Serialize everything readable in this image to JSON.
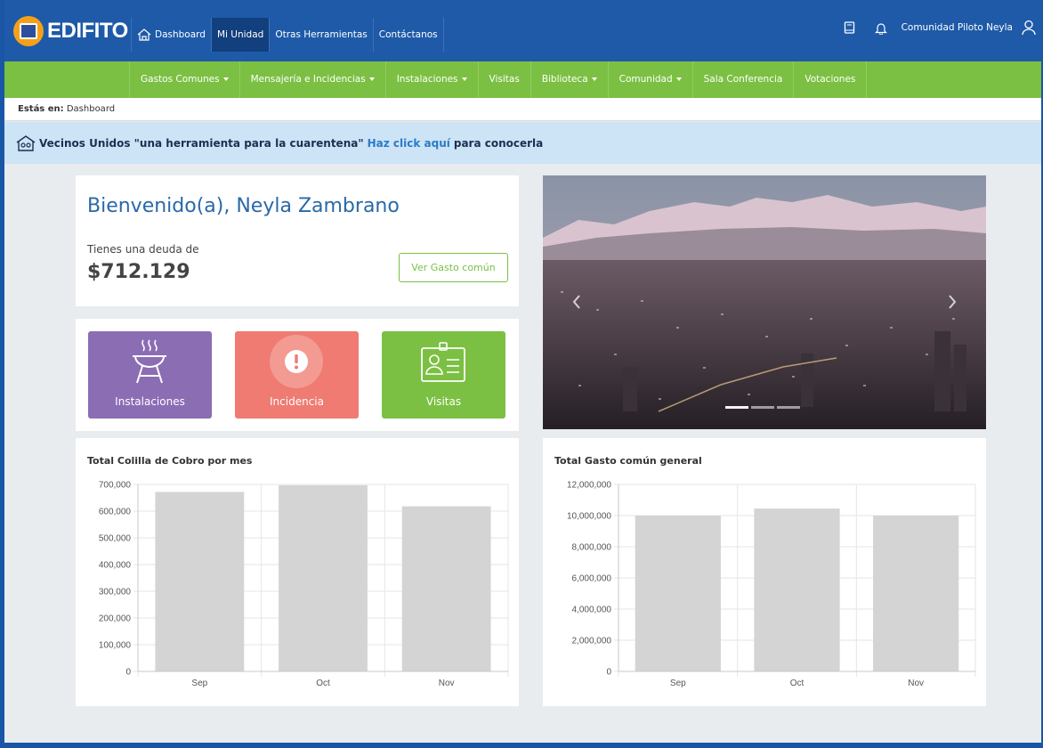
{
  "app": {
    "logo_text": "EDIFITO"
  },
  "top_nav": [
    {
      "label": "Dashboard",
      "icon": "home-icon",
      "active": false
    },
    {
      "label": "Mi Unidad",
      "active": true
    },
    {
      "label": "Otras Herramientas",
      "active": false
    },
    {
      "label": "Contáctanos",
      "active": false
    }
  ],
  "top_right": {
    "community": "Comunidad Piloto Neyla",
    "icons": [
      "book-icon",
      "bell-icon",
      "user-icon"
    ]
  },
  "green_nav": [
    {
      "label": "Gastos Comunes",
      "dropdown": true
    },
    {
      "label": "Mensajería e Incidencias",
      "dropdown": true
    },
    {
      "label": "Instalaciones",
      "dropdown": true
    },
    {
      "label": "Visitas",
      "dropdown": false
    },
    {
      "label": "Biblioteca",
      "dropdown": true
    },
    {
      "label": "Comunidad",
      "dropdown": true
    },
    {
      "label": "Sala Conferencia",
      "dropdown": false
    },
    {
      "label": "Votaciones",
      "dropdown": false
    }
  ],
  "breadcrumb": {
    "prefix": "Estás en:",
    "current": "Dashboard"
  },
  "banner": {
    "text": "Vecinos Unidos \"una herramienta para la cuarentena\"",
    "link": "Haz click aquí",
    "suffix": "para conocerla"
  },
  "welcome": {
    "title": "Bienvenido(a), Neyla Zambrano",
    "debt_label": "Tienes una deuda de",
    "debt_amount": "$712.129",
    "button": "Ver Gasto común"
  },
  "shortcuts": [
    {
      "label": "Instalaciones",
      "icon": "grill-icon",
      "color": "#8b6db4"
    },
    {
      "label": "Incidencia",
      "icon": "alert-icon",
      "color": "#ef7b72"
    },
    {
      "label": "Visitas",
      "icon": "visitor-badge-icon",
      "color": "#7bc043"
    }
  ],
  "carousel": {
    "indicators": 3,
    "active_index": 0
  },
  "chart_data": [
    {
      "type": "bar",
      "title": "Total Colilla de Cobro por mes",
      "categories": [
        "Sep",
        "Oct",
        "Nov"
      ],
      "values": [
        672000,
        697000,
        618000
      ],
      "yticks": [
        "0",
        "100,000",
        "200,000",
        "300,000",
        "400,000",
        "500,000",
        "600,000",
        "700,000"
      ],
      "ylim": [
        0,
        700000
      ],
      "bar_color": "#d4d4d4",
      "grid": true
    },
    {
      "type": "bar",
      "title": "Total Gasto común general",
      "categories": [
        "Sep",
        "Oct",
        "Nov"
      ],
      "values": [
        10000000,
        10450000,
        10000000
      ],
      "yticks": [
        "0",
        "2,000,000",
        "4,000,000",
        "6,000,000",
        "8,000,000",
        "10,000,000",
        "12,000,000"
      ],
      "ylim": [
        0,
        12000000
      ],
      "bar_color": "#d4d4d4",
      "grid": true
    }
  ]
}
